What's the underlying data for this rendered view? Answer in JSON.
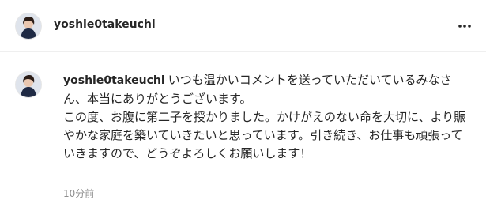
{
  "post_header": {
    "username": "yoshie0takeuchi",
    "avatar": "profile-photo",
    "more_icon": "ellipsis-horizontal-icon"
  },
  "comment": {
    "username": "yoshie0takeuchi",
    "avatar": "profile-photo",
    "text": "いつも温かいコメントを送っていただいているみなさん、本当にありがとうございます。\nこの度、お腹に第二子を授かりました。かけがえのない命を大切に、より賑やかな家庭を築いていきたいと思っています。引き続き、お仕事も頑張っていきますので、どうぞよろしくお願いします！",
    "timestamp": "10分前"
  },
  "colors": {
    "text": "#262626",
    "secondary_text": "#8e8e8e",
    "divider": "#efefef",
    "background": "#ffffff"
  }
}
